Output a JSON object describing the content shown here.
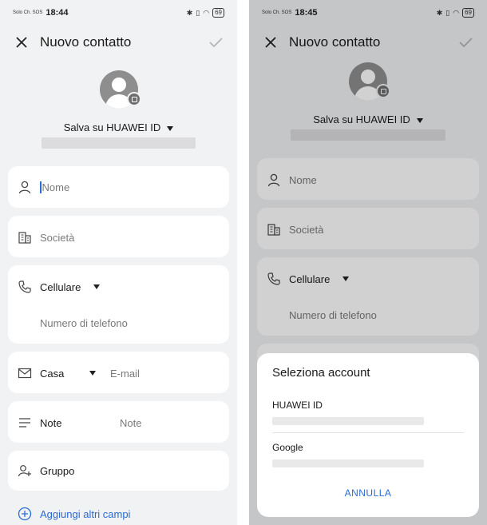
{
  "left": {
    "status": {
      "carrier": "Solo Ch. SOS",
      "time": "18:44",
      "battery": "69"
    },
    "header": {
      "title": "Nuovo contatto"
    },
    "save_on": "Salva su HUAWEI ID",
    "fields": {
      "name_placeholder": "Nome",
      "company_placeholder": "Società",
      "phone_type": "Cellulare",
      "phone_placeholder": "Numero di telefono",
      "email_type": "Casa",
      "email_placeholder": "E-mail",
      "note_label": "Note",
      "note_placeholder": "Note",
      "group_label": "Gruppo",
      "add_more": "Aggiungi altri campi"
    }
  },
  "right": {
    "status": {
      "carrier": "Solo Ch. SOS",
      "time": "18:45",
      "battery": "69"
    },
    "header": {
      "title": "Nuovo contatto"
    },
    "save_on": "Salva su HUAWEI ID",
    "fields": {
      "name_placeholder": "Nome",
      "company_placeholder": "Società",
      "phone_type": "Cellulare",
      "phone_placeholder": "Numero di telefono"
    },
    "dialog": {
      "title": "Seleziona account",
      "accounts": [
        {
          "name": "HUAWEI ID"
        },
        {
          "name": "Google"
        }
      ],
      "cancel": "ANNULLA"
    }
  },
  "colors": {
    "accent": "#2a6bd6",
    "background": "#f1f2f4",
    "card": "#ffffff"
  }
}
